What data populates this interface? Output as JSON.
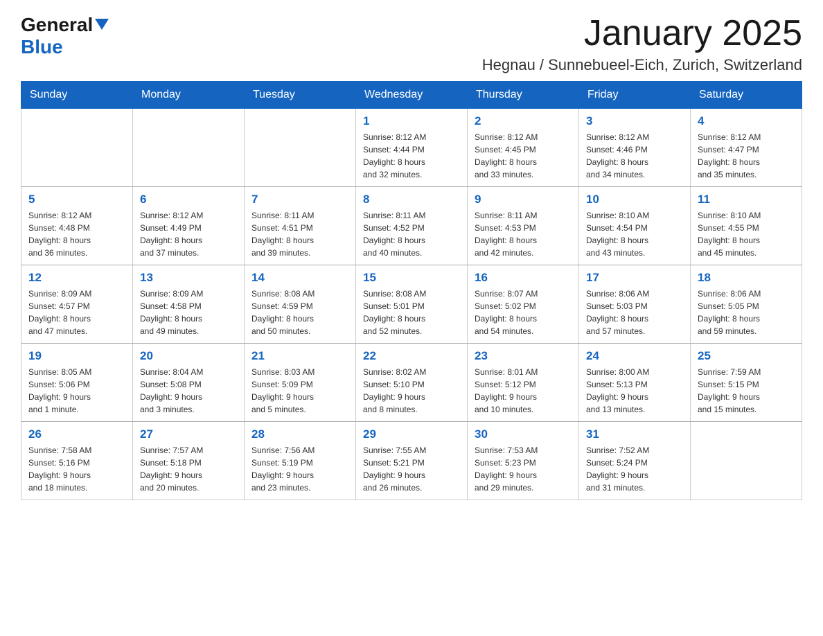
{
  "logo": {
    "text_general": "General",
    "triangle": "▶",
    "text_blue": "Blue"
  },
  "title": "January 2025",
  "subtitle": "Hegnau / Sunnebueel-Eich, Zurich, Switzerland",
  "days_of_week": [
    "Sunday",
    "Monday",
    "Tuesday",
    "Wednesday",
    "Thursday",
    "Friday",
    "Saturday"
  ],
  "weeks": [
    [
      {
        "day": "",
        "info": ""
      },
      {
        "day": "",
        "info": ""
      },
      {
        "day": "",
        "info": ""
      },
      {
        "day": "1",
        "info": "Sunrise: 8:12 AM\nSunset: 4:44 PM\nDaylight: 8 hours\nand 32 minutes."
      },
      {
        "day": "2",
        "info": "Sunrise: 8:12 AM\nSunset: 4:45 PM\nDaylight: 8 hours\nand 33 minutes."
      },
      {
        "day": "3",
        "info": "Sunrise: 8:12 AM\nSunset: 4:46 PM\nDaylight: 8 hours\nand 34 minutes."
      },
      {
        "day": "4",
        "info": "Sunrise: 8:12 AM\nSunset: 4:47 PM\nDaylight: 8 hours\nand 35 minutes."
      }
    ],
    [
      {
        "day": "5",
        "info": "Sunrise: 8:12 AM\nSunset: 4:48 PM\nDaylight: 8 hours\nand 36 minutes."
      },
      {
        "day": "6",
        "info": "Sunrise: 8:12 AM\nSunset: 4:49 PM\nDaylight: 8 hours\nand 37 minutes."
      },
      {
        "day": "7",
        "info": "Sunrise: 8:11 AM\nSunset: 4:51 PM\nDaylight: 8 hours\nand 39 minutes."
      },
      {
        "day": "8",
        "info": "Sunrise: 8:11 AM\nSunset: 4:52 PM\nDaylight: 8 hours\nand 40 minutes."
      },
      {
        "day": "9",
        "info": "Sunrise: 8:11 AM\nSunset: 4:53 PM\nDaylight: 8 hours\nand 42 minutes."
      },
      {
        "day": "10",
        "info": "Sunrise: 8:10 AM\nSunset: 4:54 PM\nDaylight: 8 hours\nand 43 minutes."
      },
      {
        "day": "11",
        "info": "Sunrise: 8:10 AM\nSunset: 4:55 PM\nDaylight: 8 hours\nand 45 minutes."
      }
    ],
    [
      {
        "day": "12",
        "info": "Sunrise: 8:09 AM\nSunset: 4:57 PM\nDaylight: 8 hours\nand 47 minutes."
      },
      {
        "day": "13",
        "info": "Sunrise: 8:09 AM\nSunset: 4:58 PM\nDaylight: 8 hours\nand 49 minutes."
      },
      {
        "day": "14",
        "info": "Sunrise: 8:08 AM\nSunset: 4:59 PM\nDaylight: 8 hours\nand 50 minutes."
      },
      {
        "day": "15",
        "info": "Sunrise: 8:08 AM\nSunset: 5:01 PM\nDaylight: 8 hours\nand 52 minutes."
      },
      {
        "day": "16",
        "info": "Sunrise: 8:07 AM\nSunset: 5:02 PM\nDaylight: 8 hours\nand 54 minutes."
      },
      {
        "day": "17",
        "info": "Sunrise: 8:06 AM\nSunset: 5:03 PM\nDaylight: 8 hours\nand 57 minutes."
      },
      {
        "day": "18",
        "info": "Sunrise: 8:06 AM\nSunset: 5:05 PM\nDaylight: 8 hours\nand 59 minutes."
      }
    ],
    [
      {
        "day": "19",
        "info": "Sunrise: 8:05 AM\nSunset: 5:06 PM\nDaylight: 9 hours\nand 1 minute."
      },
      {
        "day": "20",
        "info": "Sunrise: 8:04 AM\nSunset: 5:08 PM\nDaylight: 9 hours\nand 3 minutes."
      },
      {
        "day": "21",
        "info": "Sunrise: 8:03 AM\nSunset: 5:09 PM\nDaylight: 9 hours\nand 5 minutes."
      },
      {
        "day": "22",
        "info": "Sunrise: 8:02 AM\nSunset: 5:10 PM\nDaylight: 9 hours\nand 8 minutes."
      },
      {
        "day": "23",
        "info": "Sunrise: 8:01 AM\nSunset: 5:12 PM\nDaylight: 9 hours\nand 10 minutes."
      },
      {
        "day": "24",
        "info": "Sunrise: 8:00 AM\nSunset: 5:13 PM\nDaylight: 9 hours\nand 13 minutes."
      },
      {
        "day": "25",
        "info": "Sunrise: 7:59 AM\nSunset: 5:15 PM\nDaylight: 9 hours\nand 15 minutes."
      }
    ],
    [
      {
        "day": "26",
        "info": "Sunrise: 7:58 AM\nSunset: 5:16 PM\nDaylight: 9 hours\nand 18 minutes."
      },
      {
        "day": "27",
        "info": "Sunrise: 7:57 AM\nSunset: 5:18 PM\nDaylight: 9 hours\nand 20 minutes."
      },
      {
        "day": "28",
        "info": "Sunrise: 7:56 AM\nSunset: 5:19 PM\nDaylight: 9 hours\nand 23 minutes."
      },
      {
        "day": "29",
        "info": "Sunrise: 7:55 AM\nSunset: 5:21 PM\nDaylight: 9 hours\nand 26 minutes."
      },
      {
        "day": "30",
        "info": "Sunrise: 7:53 AM\nSunset: 5:23 PM\nDaylight: 9 hours\nand 29 minutes."
      },
      {
        "day": "31",
        "info": "Sunrise: 7:52 AM\nSunset: 5:24 PM\nDaylight: 9 hours\nand 31 minutes."
      },
      {
        "day": "",
        "info": ""
      }
    ]
  ]
}
